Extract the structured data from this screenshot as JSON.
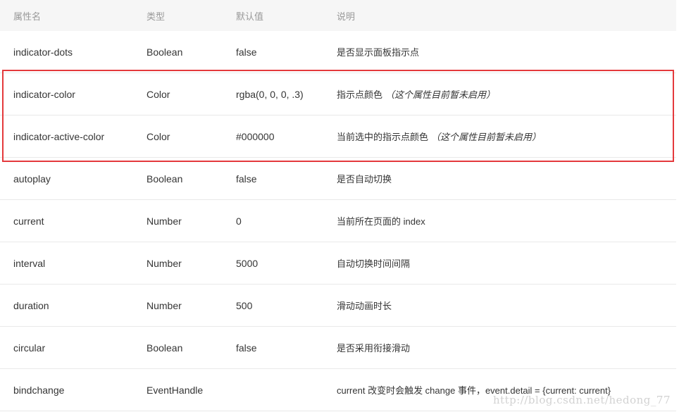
{
  "header": {
    "name": "属性名",
    "type": "类型",
    "default": "默认值",
    "description": "说明"
  },
  "rows": [
    {
      "name": "indicator-dots",
      "type": "Boolean",
      "default": "false",
      "description": "是否显示面板指示点",
      "note": ""
    },
    {
      "name": "indicator-color",
      "type": "Color",
      "default": "rgba(0, 0, 0, .3)",
      "description": "指示点颜色",
      "note": "（这个属性目前暂未启用）"
    },
    {
      "name": "indicator-active-color",
      "type": "Color",
      "default": "#000000",
      "description": "当前选中的指示点颜色",
      "note": "（这个属性目前暂未启用）"
    },
    {
      "name": "autoplay",
      "type": "Boolean",
      "default": "false",
      "description": "是否自动切换",
      "note": ""
    },
    {
      "name": "current",
      "type": "Number",
      "default": "0",
      "description": "当前所在页面的 index",
      "note": ""
    },
    {
      "name": "interval",
      "type": "Number",
      "default": "5000",
      "description": "自动切换时间间隔",
      "note": ""
    },
    {
      "name": "duration",
      "type": "Number",
      "default": "500",
      "description": "滑动动画时长",
      "note": ""
    },
    {
      "name": "circular",
      "type": "Boolean",
      "default": "false",
      "description": "是否采用衔接滑动",
      "note": ""
    },
    {
      "name": "bindchange",
      "type": "EventHandle",
      "default": "",
      "description": "current 改变时会触发 change 事件，event.detail = {current: current}",
      "note": ""
    }
  ],
  "watermark": "http://blog.csdn.net/hedong_77",
  "colors": {
    "highlight_border": "#e4393c",
    "header_background": "#f6f6f6"
  }
}
